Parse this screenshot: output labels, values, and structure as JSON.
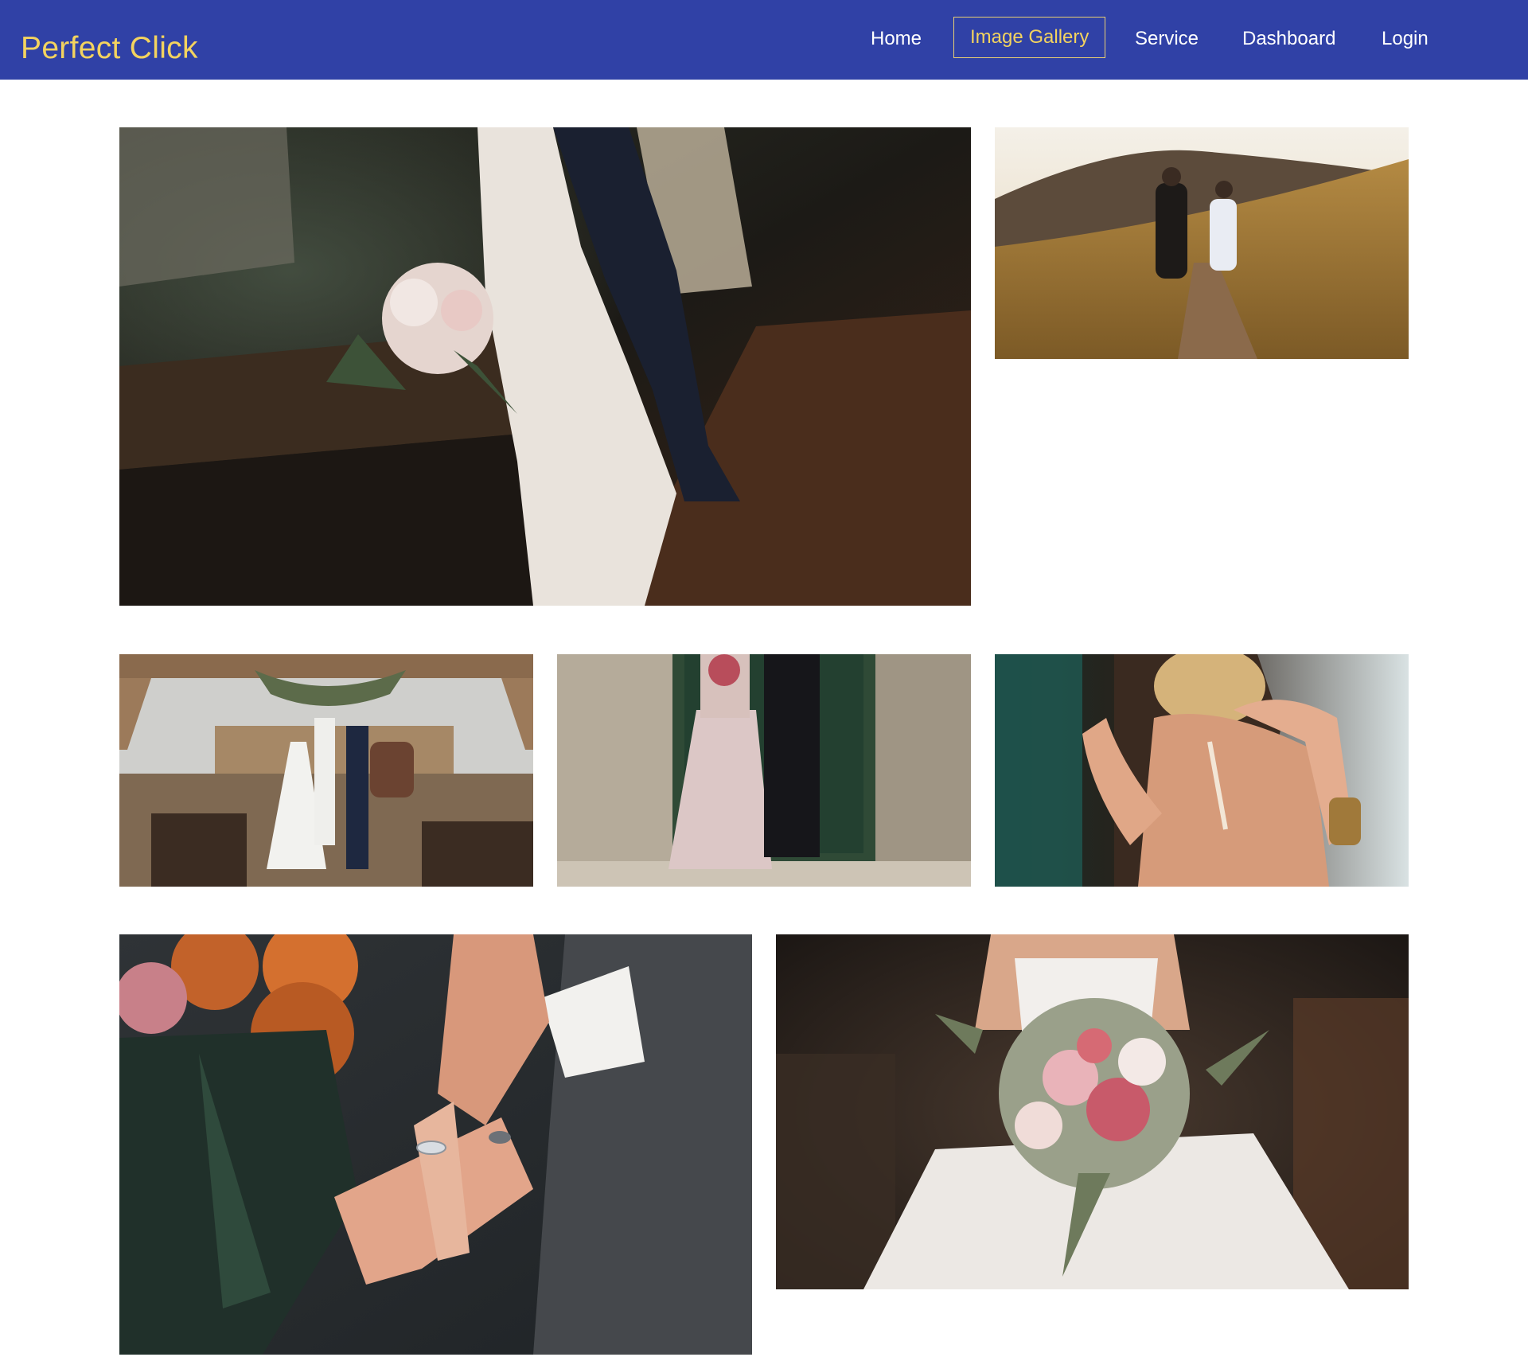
{
  "brand": {
    "name": "Perfect Click",
    "color": "#f3d35f"
  },
  "nav": {
    "background": "#3041a6",
    "active_color": "#f3d35f",
    "items": [
      {
        "label": "Home",
        "active": false
      },
      {
        "label": "Image Gallery",
        "active": true
      },
      {
        "label": "Service",
        "active": false
      },
      {
        "label": "Dashboard",
        "active": false
      },
      {
        "label": "Login",
        "active": false
      }
    ]
  },
  "gallery": {
    "photos": [
      {
        "subject": "bride and groom seated on wooden steps in forest with bouquet"
      },
      {
        "subject": "couple walking hand in hand on hillside path at sunset"
      },
      {
        "subject": "outdoor wedding ceremony under wooden pergola"
      },
      {
        "subject": "bride and groom standing in front of stone doorway"
      },
      {
        "subject": "bride's hair being styled with ribbon"
      },
      {
        "subject": "couple's hands with wedding rings beside orange roses"
      },
      {
        "subject": "bride holding pink and white bouquet"
      }
    ]
  }
}
